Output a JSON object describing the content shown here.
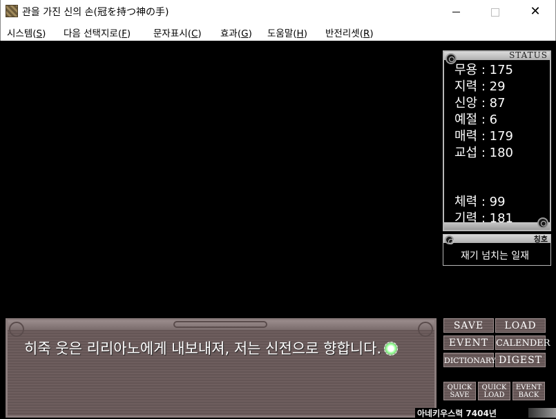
{
  "window": {
    "title": "관을 가진 신의 손(冠を持つ神の手)",
    "minimize": "—",
    "maximize": "☐",
    "close": "✕"
  },
  "menu": [
    {
      "label": "시스템",
      "key": "S"
    },
    {
      "label": "다음 선택지로",
      "key": "F"
    },
    {
      "label": "문자표시",
      "key": "C"
    },
    {
      "label": "효과",
      "key": "G"
    },
    {
      "label": "도움말",
      "key": "H"
    },
    {
      "label": "반전리셋",
      "key": "R"
    }
  ],
  "status": {
    "header": "STATUS",
    "stats": [
      "무용 : 175",
      "지력 : 29",
      "신앙 : 87",
      "예절 : 6",
      "매력 : 179",
      "교섭 : 180"
    ],
    "vitals": [
      "체력 : 99",
      "기력 : 181"
    ]
  },
  "title_panel": {
    "label": "칭호",
    "value": "재기 넘치는 일재"
  },
  "message": {
    "text": "히죽 웃은 리리아노에게 내보내져, 저는 신전으로 향합니다."
  },
  "buttons": {
    "save": "SAVE",
    "load": "LOAD",
    "event": "EVENT",
    "calender": "CALENDER",
    "dictionary": "DICTIONARY",
    "digest": "DIGEST",
    "quick_save_1": "QUICK",
    "quick_save_2": "SAVE",
    "quick_load_1": "QUICK",
    "quick_load_2": "LOAD",
    "event_back_1": "EVENT",
    "event_back_2": "BACK"
  },
  "date": {
    "text": "아네키우스력 7404년"
  },
  "colors": {
    "panel_border": "#b8b8b8",
    "message_bg": "#6e5e5e",
    "text": "#ffffff"
  }
}
